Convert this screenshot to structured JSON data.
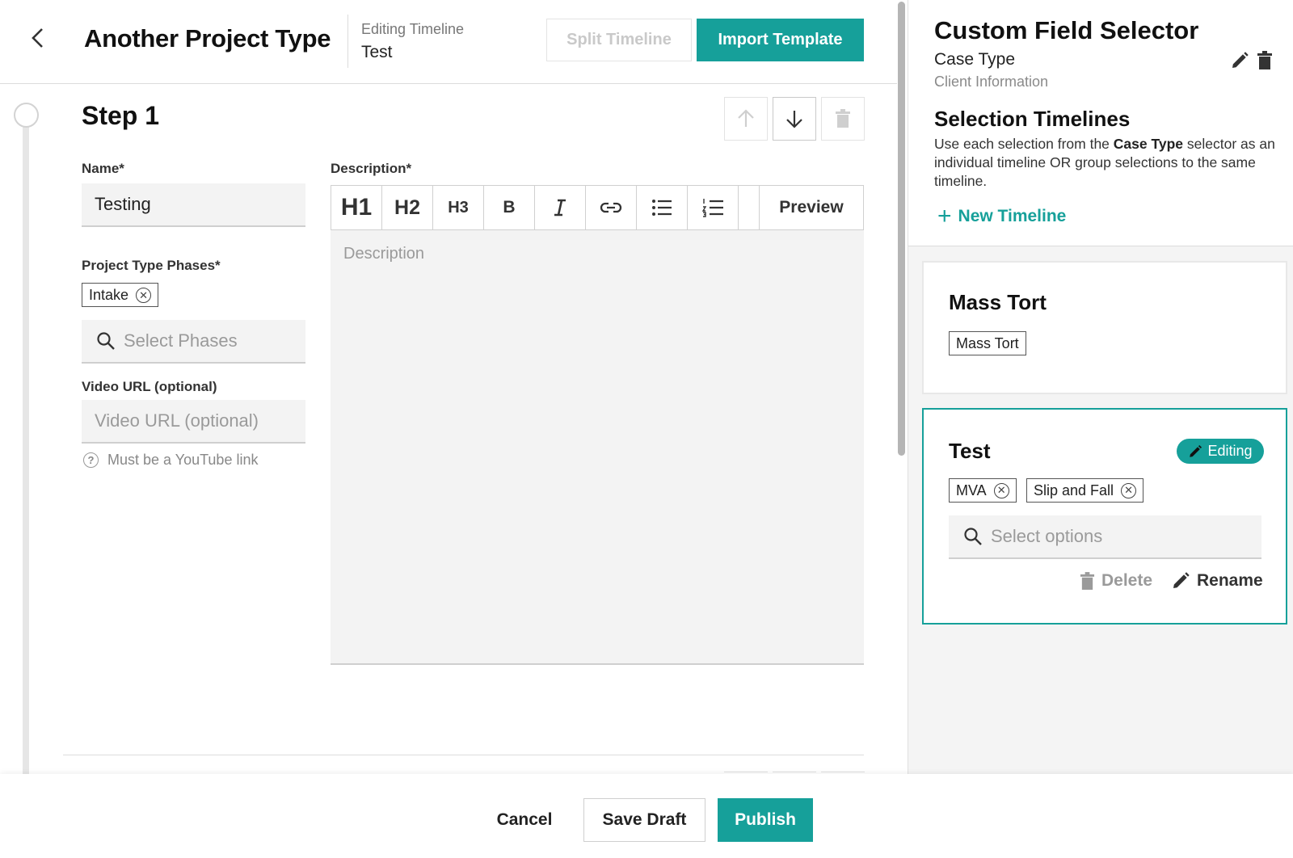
{
  "colors": {
    "accent": "#16a09a",
    "disabled": "#c9c9c9",
    "field_bg": "#f3f3f3"
  },
  "header": {
    "back_icon": "chevron-left-icon",
    "title": "Another Project Type",
    "editing_label": "Editing Timeline",
    "editing_value": "Test",
    "split_label": "Split Timeline",
    "import_label": "Import Template"
  },
  "step": {
    "title": "Step 1",
    "controls": {
      "up_icon": "arrow-up-icon",
      "down_icon": "arrow-down-icon",
      "delete_icon": "trash-icon"
    },
    "name_label": "Name*",
    "name_value": "Testing",
    "phases_label": "Project Type Phases*",
    "phases_chips": [
      "Intake"
    ],
    "phases_placeholder": "Select Phases",
    "video_label": "Video URL (optional)",
    "video_placeholder": "Video URL (optional)",
    "video_hint": "Must be a YouTube link",
    "description_label": "Description*",
    "description_placeholder": "Description",
    "toolbar": {
      "h1": "H1",
      "h2": "H2",
      "h3": "H3",
      "bold": "B",
      "italic": "I",
      "link_icon": "link-icon",
      "bullet_icon": "bulleted-list-icon",
      "numbered_icon": "numbered-list-icon",
      "preview": "Preview"
    }
  },
  "panel": {
    "title": "Custom Field Selector",
    "field_name": "Case Type",
    "field_group": "Client Information",
    "selection_title": "Selection Timelines",
    "selection_desc_pre": "Use each selection from the ",
    "selection_desc_bold": "Case Type",
    "selection_desc_post": " selector as an individual timeline OR group selections to the same timeline.",
    "new_timeline": "New Timeline",
    "cards": [
      {
        "title": "Mass Tort",
        "chips": [
          "Mass Tort"
        ]
      },
      {
        "title": "Test",
        "badge": "Editing",
        "chips": [
          "MVA",
          "Slip and Fall"
        ],
        "select_placeholder": "Select options",
        "delete_label": "Delete",
        "rename_label": "Rename"
      }
    ]
  },
  "footer": {
    "cancel": "Cancel",
    "save_draft": "Save Draft",
    "publish": "Publish"
  }
}
